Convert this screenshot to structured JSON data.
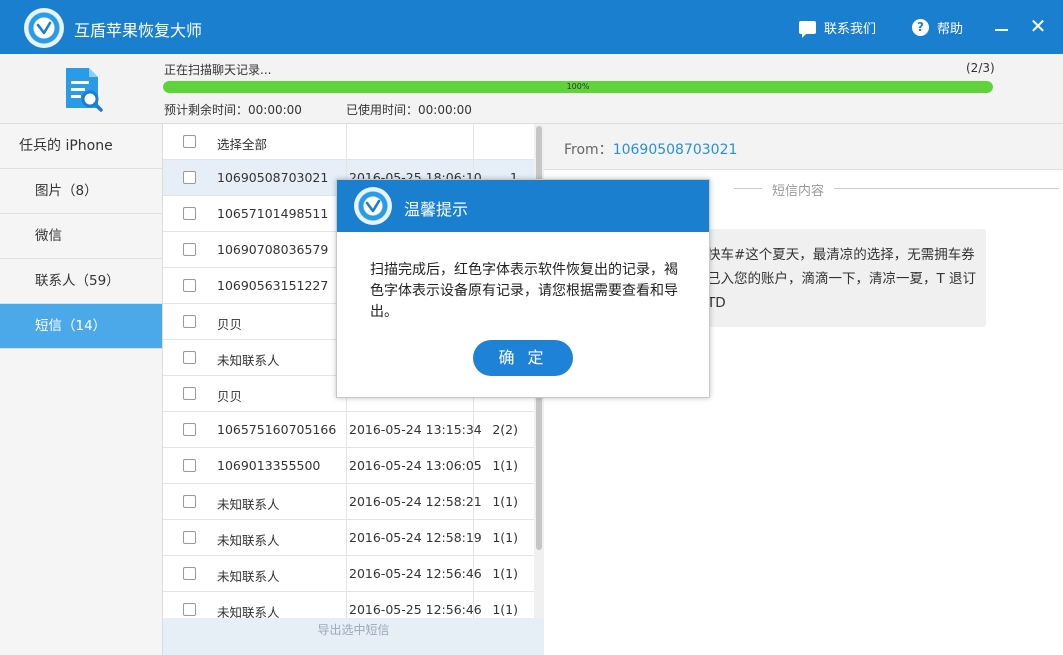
{
  "window": {
    "title": "互盾苹果恢复大师",
    "contact_label": "联系我们",
    "help_label": "帮助",
    "close_glyph": "✕"
  },
  "progress": {
    "status": "正在扫描聊天记录...",
    "step": "(2/3)",
    "percent": 100,
    "percent_label": "100%",
    "time_left": "预计剩余时间：00:00:00",
    "time_used": "已使用时间：00:00:00"
  },
  "sidebar": {
    "device": "任兵的 iPhone",
    "items": [
      {
        "label": "图片（8）"
      },
      {
        "label": "微信"
      },
      {
        "label": "联系人（59）"
      },
      {
        "label": "短信（14）"
      }
    ]
  },
  "list": {
    "select_all": "选择全部",
    "rows": [
      {
        "name": "10690508703021",
        "date": "2016-05-25 18:06:10",
        "count": "1"
      },
      {
        "name": "10657101498511",
        "date": "",
        "count": ""
      },
      {
        "name": "10690708036579",
        "date": "",
        "count": ""
      },
      {
        "name": "10690563151227",
        "date": "",
        "count": ""
      },
      {
        "name": "贝贝",
        "date": "",
        "count": ""
      },
      {
        "name": "未知联系人",
        "date": "",
        "count": ""
      },
      {
        "name": "贝贝",
        "date": "2016-05-25 08:39:40",
        "count": "1"
      },
      {
        "name": "106575160705166",
        "date": "2016-05-24 13:15:34",
        "count": "2(2)"
      },
      {
        "name": "1069013355500",
        "date": "2016-05-24 13:06:05",
        "count": "1(1)"
      },
      {
        "name": "未知联系人",
        "date": "2016-05-24 12:58:21",
        "count": "1(1)"
      },
      {
        "name": "未知联系人",
        "date": "2016-05-24 12:58:19",
        "count": "1(1)"
      },
      {
        "name": "未知联系人",
        "date": "2016-05-24 12:56:46",
        "count": "1(1)"
      },
      {
        "name": "未知联系人",
        "date": "2016-05-25 12:56:46",
        "count": "1(1)"
      }
    ],
    "export_label": "导出选中短信"
  },
  "detail": {
    "from_label": "From：",
    "from_number": "10690508703021",
    "content_title": "短信内容",
    "message": "快车#这个夏天，最清凉的选择，无需拥车券已入您的账户，滴滴一下，清凉一夏，T 退订TD"
  },
  "dialog": {
    "title": "温馨提示",
    "message": "扫描完成后，红色字体表示软件恢复出的记录，褐色字体表示设备原有记录，请您根据需要查看和导出。",
    "ok_label": "确 定"
  },
  "colors": {
    "brand": "#1b7fcf",
    "progress": "#5ed43a",
    "sidebar_active": "#4ba9ea",
    "link": "#2a8fd8"
  }
}
